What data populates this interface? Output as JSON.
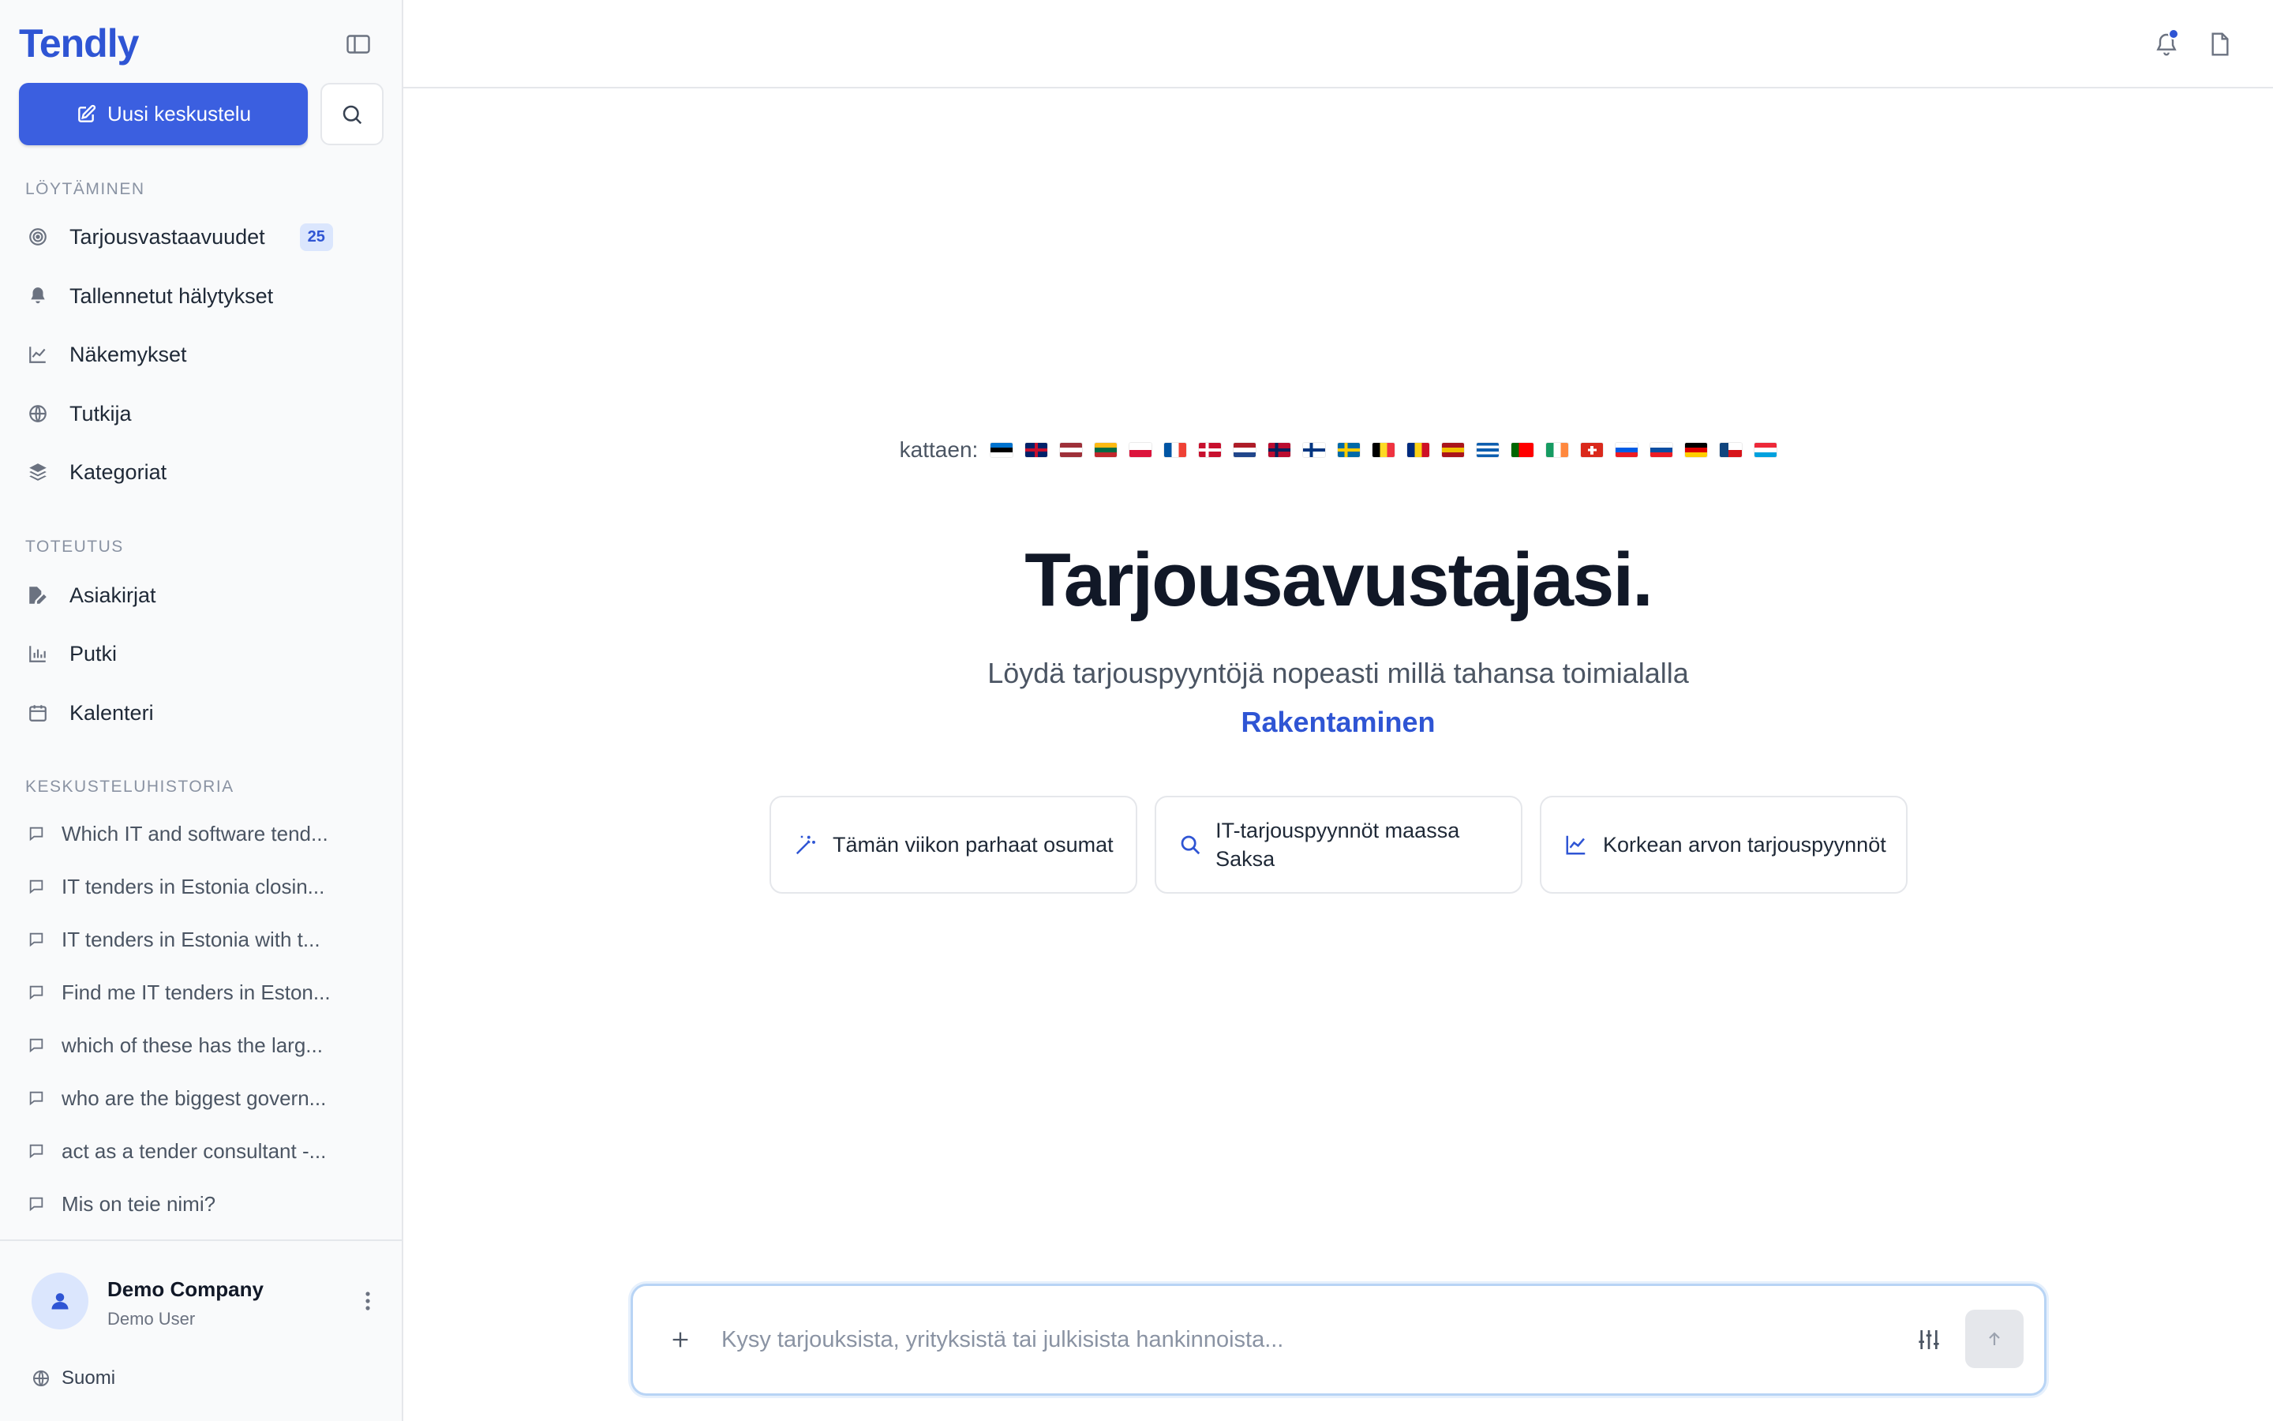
{
  "app": {
    "logo": "Tendly"
  },
  "sidebar": {
    "new_chat_label": "Uusi keskustelu",
    "sections": {
      "discovery": "LÖYTÄMINEN",
      "execution": "TOTEUTUS",
      "history": "KESKUSTELUHISTORIA"
    },
    "discovery_items": [
      {
        "label": "Tarjousvastaavuudet",
        "icon": "target-icon",
        "badge": "25"
      },
      {
        "label": "Tallennetut hälytykset",
        "icon": "bell-icon"
      },
      {
        "label": "Näkemykset",
        "icon": "chart-line-icon"
      },
      {
        "label": "Tutkija",
        "icon": "globe-icon"
      },
      {
        "label": "Kategoriat",
        "icon": "layers-icon"
      }
    ],
    "execution_items": [
      {
        "label": "Asiakirjat",
        "icon": "file-edit-icon"
      },
      {
        "label": "Putki",
        "icon": "bar-chart-icon"
      },
      {
        "label": "Kalenteri",
        "icon": "calendar-icon"
      }
    ],
    "history_items": [
      "Which IT and software tend...",
      "IT tenders in Estonia closin...",
      "IT tenders in Estonia with t...",
      "Find me IT tenders in Eston...",
      "which of these has the larg...",
      "who are the biggest govern...",
      "act as a tender consultant -...",
      "Mis on teie nimi?"
    ],
    "footer": {
      "company": "Demo Company",
      "user": "Demo User",
      "language": "Suomi"
    }
  },
  "main": {
    "covering_label": "kattaen:",
    "flags": [
      {
        "name": "estonia",
        "colors": [
          "#0072ce",
          "#000000",
          "#ffffff"
        ],
        "dir": "h"
      },
      {
        "name": "united-kingdom",
        "colors": [
          "#012169",
          "#c8102e",
          "#012169"
        ],
        "dir": "uk"
      },
      {
        "name": "latvia",
        "colors": [
          "#9e3039",
          "#ffffff",
          "#9e3039"
        ],
        "dir": "h"
      },
      {
        "name": "lithuania",
        "colors": [
          "#fdb913",
          "#006a44",
          "#c1272d"
        ],
        "dir": "h"
      },
      {
        "name": "poland",
        "colors": [
          "#ffffff",
          "#dc143c"
        ],
        "dir": "h"
      },
      {
        "name": "france",
        "colors": [
          "#0055a4",
          "#ffffff",
          "#ef4135"
        ],
        "dir": "v"
      },
      {
        "name": "denmark",
        "colors": [
          "#c8102e",
          "#ffffff"
        ],
        "dir": "nordic"
      },
      {
        "name": "netherlands",
        "colors": [
          "#ae1c28",
          "#ffffff",
          "#21468b"
        ],
        "dir": "h"
      },
      {
        "name": "norway",
        "colors": [
          "#ba0c2f",
          "#00205b"
        ],
        "dir": "nordic"
      },
      {
        "name": "finland",
        "colors": [
          "#ffffff",
          "#003580"
        ],
        "dir": "nordic"
      },
      {
        "name": "sweden",
        "colors": [
          "#006aa7",
          "#fecc00"
        ],
        "dir": "nordic"
      },
      {
        "name": "belgium",
        "colors": [
          "#000000",
          "#fdda24",
          "#ef3340"
        ],
        "dir": "v"
      },
      {
        "name": "romania",
        "colors": [
          "#002b7f",
          "#fcd116",
          "#ce1126"
        ],
        "dir": "v"
      },
      {
        "name": "spain",
        "colors": [
          "#aa151b",
          "#f1bf00",
          "#aa151b"
        ],
        "dir": "h"
      },
      {
        "name": "greece",
        "colors": [
          "#0d5eaf",
          "#ffffff",
          "#0d5eaf",
          "#ffffff",
          "#0d5eaf"
        ],
        "dir": "h"
      },
      {
        "name": "portugal",
        "colors": [
          "#006600",
          "#ff0000",
          "#ff0000"
        ],
        "dir": "v"
      },
      {
        "name": "ireland",
        "colors": [
          "#169b62",
          "#ffffff",
          "#ff883e"
        ],
        "dir": "v"
      },
      {
        "name": "switzerland",
        "colors": [
          "#da291c",
          "#ffffff"
        ],
        "dir": "swiss"
      },
      {
        "name": "slovenia",
        "colors": [
          "#ffffff",
          "#005ce5",
          "#ed1c24"
        ],
        "dir": "h"
      },
      {
        "name": "slovakia",
        "colors": [
          "#ffffff",
          "#0b4ea2",
          "#ee1c25"
        ],
        "dir": "h"
      },
      {
        "name": "germany",
        "colors": [
          "#000000",
          "#dd0000",
          "#ffce00"
        ],
        "dir": "h"
      },
      {
        "name": "czechia",
        "colors": [
          "#ffffff",
          "#d7141a",
          "#11457e"
        ],
        "dir": "cz"
      },
      {
        "name": "luxembourg",
        "colors": [
          "#ed2939",
          "#ffffff",
          "#00a1de"
        ],
        "dir": "h"
      }
    ],
    "title": "Tarjousavustajasi.",
    "subtitle": "Löydä tarjouspyyntöjä nopeasti millä tahansa toimialalla",
    "accent": "Rakentaminen",
    "suggestions": [
      {
        "label": "Tämän viikon parhaat osumat",
        "icon": "magic-wand-icon"
      },
      {
        "label": "IT-tarjouspyynnöt maassa Saksa",
        "icon": "search-icon"
      },
      {
        "label": "Korkean arvon tarjouspyynnöt",
        "icon": "chart-line-icon"
      }
    ],
    "composer": {
      "placeholder": "Kysy tarjouksista, yrityksistä tai julkisista hankinnoista..."
    }
  },
  "colors": {
    "accent": "#2f55d4",
    "primary_button": "#3b5fe0",
    "sidebar_bg": "#f9fafb"
  }
}
